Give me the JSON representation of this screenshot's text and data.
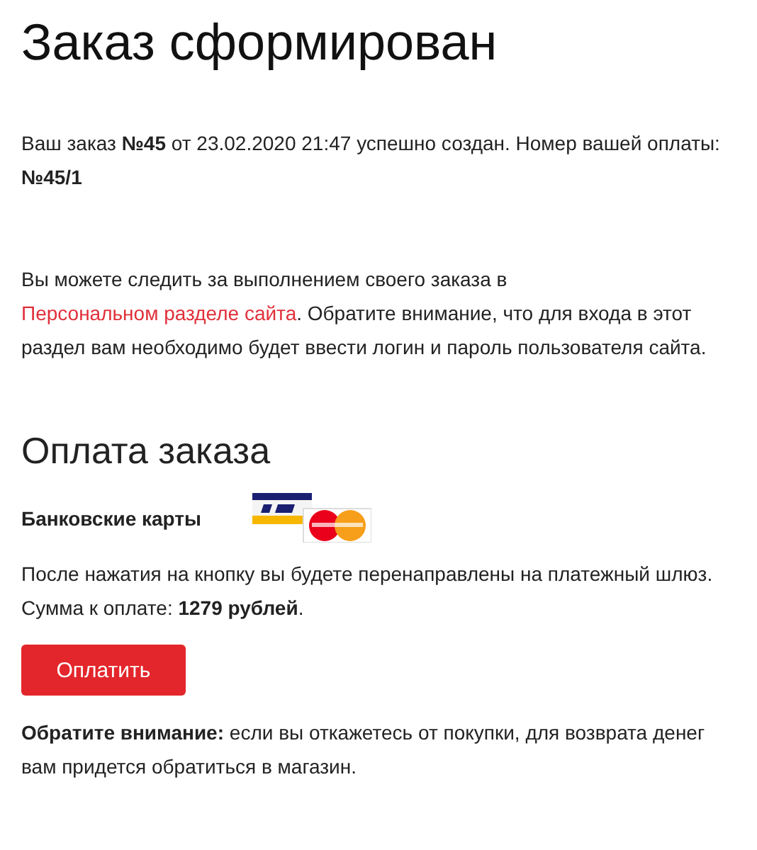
{
  "title": "Заказ сформирован",
  "order_info": "Ваш заказ **№45** от 23.02.2020 21:47 успешно создан. Номер вашей оплаты: **№45/1**",
  "tracking": {
    "before": "Вы можете следить за выполнением своего заказа в",
    "link": "Персональном разделе сайта",
    "after": ". Обратите внимание, что для входа в этот раздел вам необходимо будет ввести логин и пароль пользователя сайта."
  },
  "payment": {
    "heading": "Оплата заказа",
    "method": "Банковские карты",
    "redirect_note": "После нажатия на кнопку вы будете перенаправлены на платежный шлюз.",
    "amount": "Сумма к оплате: **1279 рублей**.",
    "button": "Оплатить",
    "warning": "**Обратите внимание:** если вы откажетесь от покупки, для возврата денег вам придется обратиться в магазин."
  }
}
